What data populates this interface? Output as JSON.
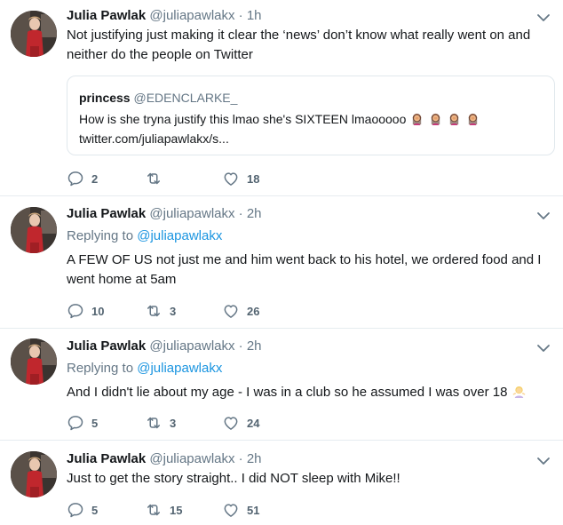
{
  "tweets": [
    {
      "name": "Julia Pawlak",
      "handle": "@juliapawlakx",
      "time": "· 1h",
      "text": "Not justifying just making it clear the ‘news’ don’t know what really went on and neither do the people on Twitter",
      "quote": {
        "name": "princess",
        "handle": "@EDENCLARKE_",
        "text": "How is she tryna justify this lmao she's SIXTEEN lmaooooo",
        "link": "twitter.com/juliapawlakx/s..."
      },
      "replies": "2",
      "retweets": "",
      "likes": "18"
    },
    {
      "name": "Julia Pawlak",
      "handle": "@juliapawlakx",
      "time": "· 2h",
      "replying_label": "Replying to",
      "replying_to": "@juliapawlakx",
      "text": "A FEW OF US not just me and him went back to his hotel, we ordered food and I went home at 5am",
      "replies": "10",
      "retweets": "3",
      "likes": "26"
    },
    {
      "name": "Julia Pawlak",
      "handle": "@juliapawlakx",
      "time": "· 2h",
      "replying_label": "Replying to",
      "replying_to": "@juliapawlakx",
      "text": "And I didn't lie about my age - I was in a club so he assumed I was over 18",
      "replies": "5",
      "retweets": "3",
      "likes": "24"
    },
    {
      "name": "Julia Pawlak",
      "handle": "@juliapawlakx",
      "time": "· 2h",
      "text": "Just to get the story straight.. I did NOT sleep with Mike!!",
      "replies": "5",
      "retweets": "15",
      "likes": "51"
    }
  ],
  "colors": {
    "text": "#14171a",
    "muted": "#657786",
    "link": "#1b95e0",
    "divider": "#e6ecf0"
  },
  "icons": [
    "reply-icon",
    "retweet-icon",
    "like-icon",
    "chevron-down-icon",
    "facepalm-emoji",
    "shrug-emoji"
  ]
}
